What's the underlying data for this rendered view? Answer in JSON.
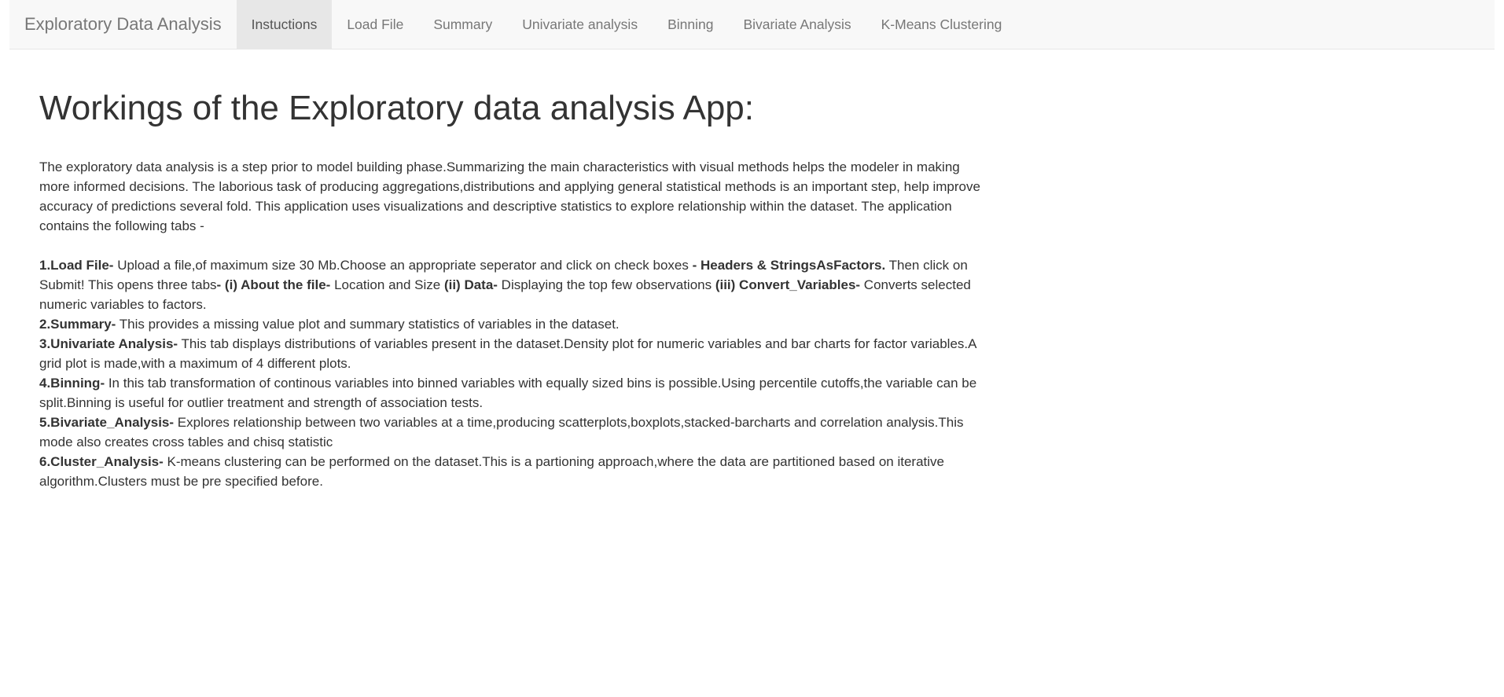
{
  "navbar": {
    "brand": "Exploratory Data Analysis",
    "tabs": [
      {
        "label": "Instuctions",
        "active": true
      },
      {
        "label": "Load File",
        "active": false
      },
      {
        "label": "Summary",
        "active": false
      },
      {
        "label": "Univariate analysis",
        "active": false
      },
      {
        "label": "Binning",
        "active": false
      },
      {
        "label": "Bivariate Analysis",
        "active": false
      },
      {
        "label": "K-Means Clustering",
        "active": false
      }
    ]
  },
  "main": {
    "title": "Workings of the Exploratory data analysis App:",
    "intro": "The exploratory data analysis is a step prior to model building phase.Summarizing the main characteristics with visual methods helps the modeler in making more informed decisions. The laborious task of producing aggregations,distributions and applying general statistical methods is an important step, help improve accuracy of predictions several fold. This application uses visualizations and descriptive statistics to explore relationship within the dataset. The application contains the following tabs -",
    "items": {
      "load_file": {
        "heading": "1.Load File-",
        "text1": " Upload a file,of maximum size 30 Mb.Choose an appropriate seperator and click on check boxes ",
        "bold1": "- Headers & StringsAsFactors.",
        "text2": " Then click on Submit! This opens three tabs",
        "bold2": "- (i) About the file-",
        "text3": " Location and Size ",
        "bold3": "(ii) Data-",
        "text4": " Displaying the top few observations ",
        "bold4": "(iii) Convert_Variables-",
        "text5": " Converts selected numeric variables to factors."
      },
      "summary": {
        "heading": "2.Summary-",
        "text": " This provides a missing value plot and summary statistics of variables in the dataset."
      },
      "univariate": {
        "heading": "3.Univariate Analysis-",
        "text": " This tab displays distributions of variables present in the dataset.Density plot for numeric variables and bar charts for factor variables.A grid plot is made,with a maximum of 4 different plots."
      },
      "binning": {
        "heading": "4.Binning-",
        "text": " In this tab transformation of continous variables into binned variables with equally sized bins is possible.Using percentile cutoffs,the variable can be split.Binning is useful for outlier treatment and strength of association tests."
      },
      "bivariate": {
        "heading": "5.Bivariate_Analysis-",
        "text": " Explores relationship between two variables at a time,producing scatterplots,boxplots,stacked-barcharts and correlation analysis.This mode also creates cross tables and chisq statistic"
      },
      "cluster": {
        "heading": "6.Cluster_Analysis-",
        "text": " K-means clustering can be performed on the dataset.This is a partioning approach,where the data are partitioned based on iterative algorithm.Clusters must be pre specified before."
      }
    }
  }
}
